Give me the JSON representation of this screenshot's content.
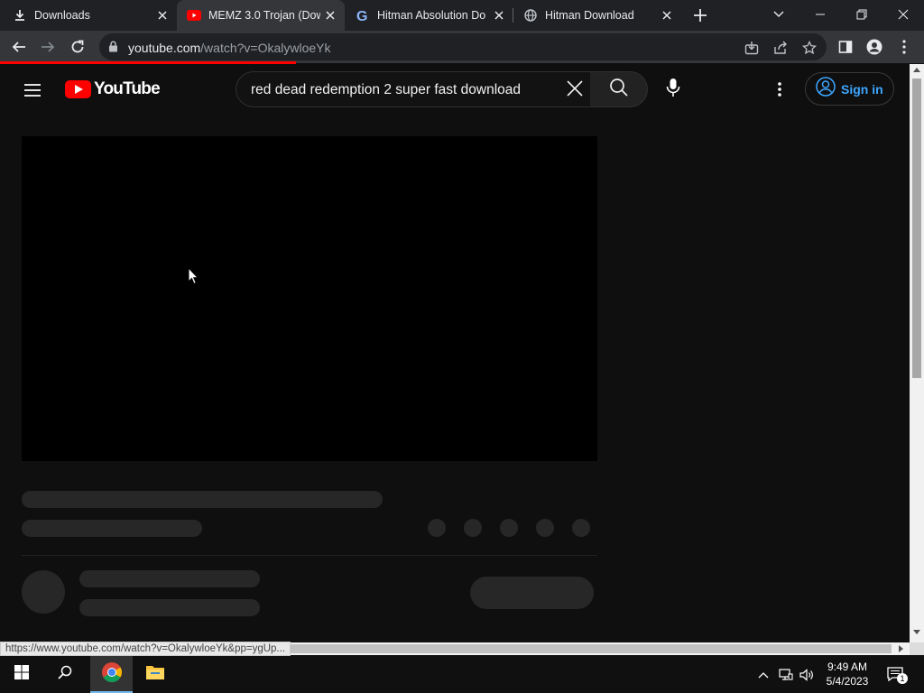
{
  "browser": {
    "tabs": [
      {
        "title": "Downloads",
        "icon": "download-icon",
        "active": false
      },
      {
        "title": "MEMZ 3.0 Trojan (Dow",
        "icon": "youtube-icon",
        "active": true
      },
      {
        "title": "Hitman Absolution Do",
        "icon": "google-icon",
        "active": false
      },
      {
        "title": "Hitman Download",
        "icon": "globe-icon",
        "active": false
      }
    ],
    "url_host": "youtube.com",
    "url_path": "/watch?v=OkalywloeYk"
  },
  "youtube": {
    "logo_text": "YouTube",
    "search_query": "red dead redemption 2 super fast download",
    "signin_label": "Sign in"
  },
  "status_url": "https://www.youtube.com/watch?v=OkalywloeYk&pp=ygUp...",
  "taskbar": {
    "time": "9:49 AM",
    "date": "5/4/2023",
    "notification_count": "1"
  },
  "colors": {
    "youtube_red": "#ff0000",
    "signin_blue": "#3ea6ff",
    "page_bg": "#0f0f0f",
    "skeleton": "#272727"
  }
}
